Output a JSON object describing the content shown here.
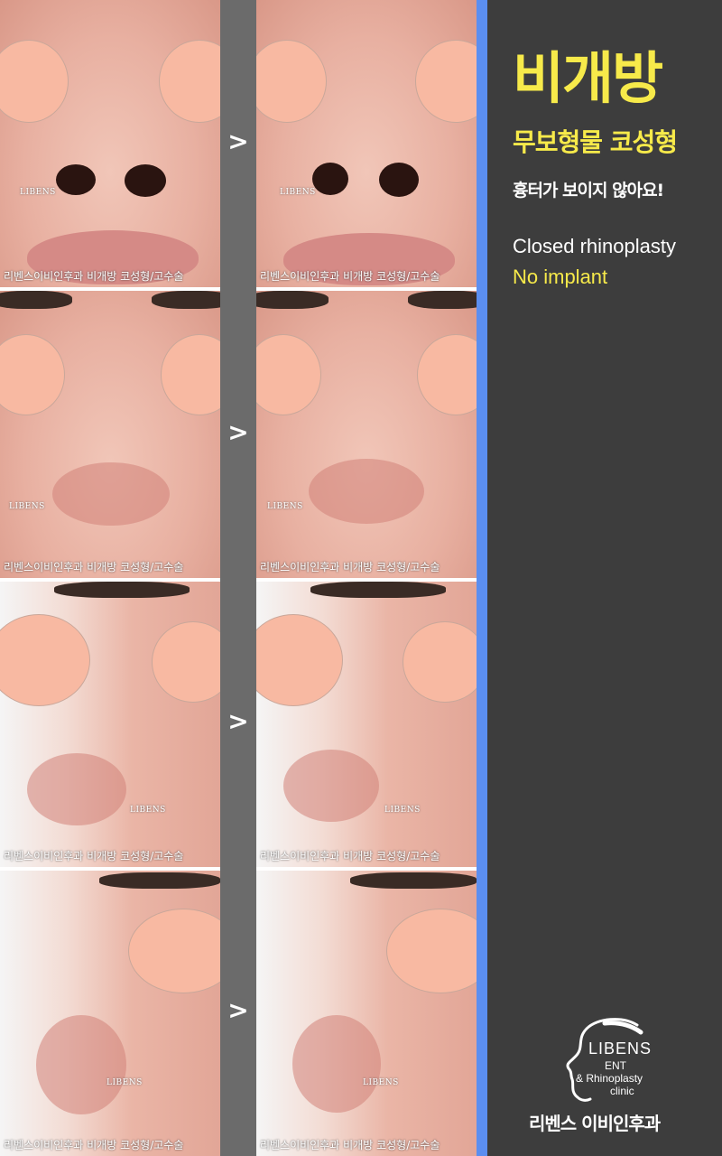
{
  "watermark": "리벤스이비인후과 비개방 코성형/고수술",
  "photo_logo": "LIBENS",
  "arrow": ">",
  "panel": {
    "title": "비개방",
    "subtitle": "무보형물 코성형",
    "tagline": "흉터가 보이지 않아요!",
    "english_line1": "Closed rhinoplasty",
    "english_line2": "No implant"
  },
  "logo": {
    "name": "LIBENS",
    "line1": "ENT",
    "line2": "& Rhinoplasty",
    "line3": "clinic"
  },
  "clinic_name": "리벤스 이비인후과",
  "colors": {
    "accent_yellow": "#f7ea4a",
    "accent_blue": "#5b8ef0",
    "panel_bg": "#3d3d3d"
  }
}
